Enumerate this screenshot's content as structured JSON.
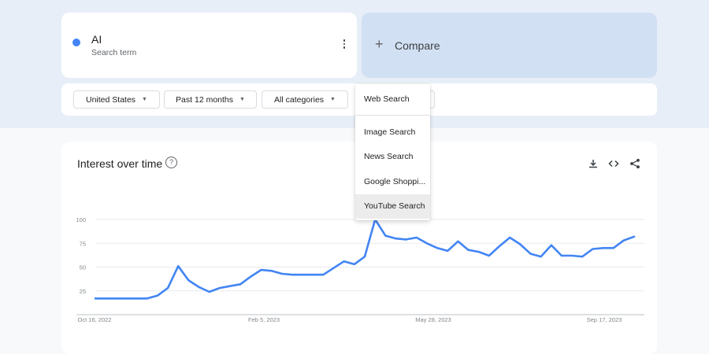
{
  "search_term": {
    "name": "AI",
    "subtitle": "Search term",
    "color": "#4285f4"
  },
  "compare": {
    "icon": "plus-icon",
    "label": "Compare"
  },
  "filters": {
    "region": "United States",
    "time_range": "Past 12 months",
    "category": "All categories",
    "property": "Web Search"
  },
  "property_menu": {
    "selected": "Web Search",
    "options": [
      "Image Search",
      "News Search",
      "Google Shoppi...",
      "YouTube Search"
    ],
    "hovered": "YouTube Search"
  },
  "interest_card": {
    "title": "Interest over time",
    "icons": [
      "help-icon",
      "download-icon",
      "embed-icon",
      "share-icon"
    ]
  },
  "chart_data": {
    "type": "line",
    "title": "",
    "xlabel": "",
    "ylabel": "",
    "ylim": [
      0,
      100
    ],
    "yticks": [
      25,
      50,
      75,
      100
    ],
    "x_tick_labels": [
      "Oct 16, 2022",
      "Feb 5, 2023",
      "May 28, 2023",
      "Sep 17, 2023"
    ],
    "grid": true,
    "series": [
      {
        "color": "#4285f4",
        "values": [
          17,
          17,
          17,
          17,
          17,
          17,
          20,
          28,
          51,
          36,
          29,
          24,
          28,
          30,
          32,
          40,
          47,
          46,
          43,
          42,
          42,
          42,
          42,
          49,
          56,
          53,
          61,
          100,
          83,
          80,
          79,
          81,
          75,
          70,
          67,
          77,
          68,
          66,
          62,
          72,
          81,
          74,
          64,
          61,
          73,
          62,
          62,
          61,
          69,
          70,
          70,
          78,
          82
        ]
      }
    ]
  }
}
